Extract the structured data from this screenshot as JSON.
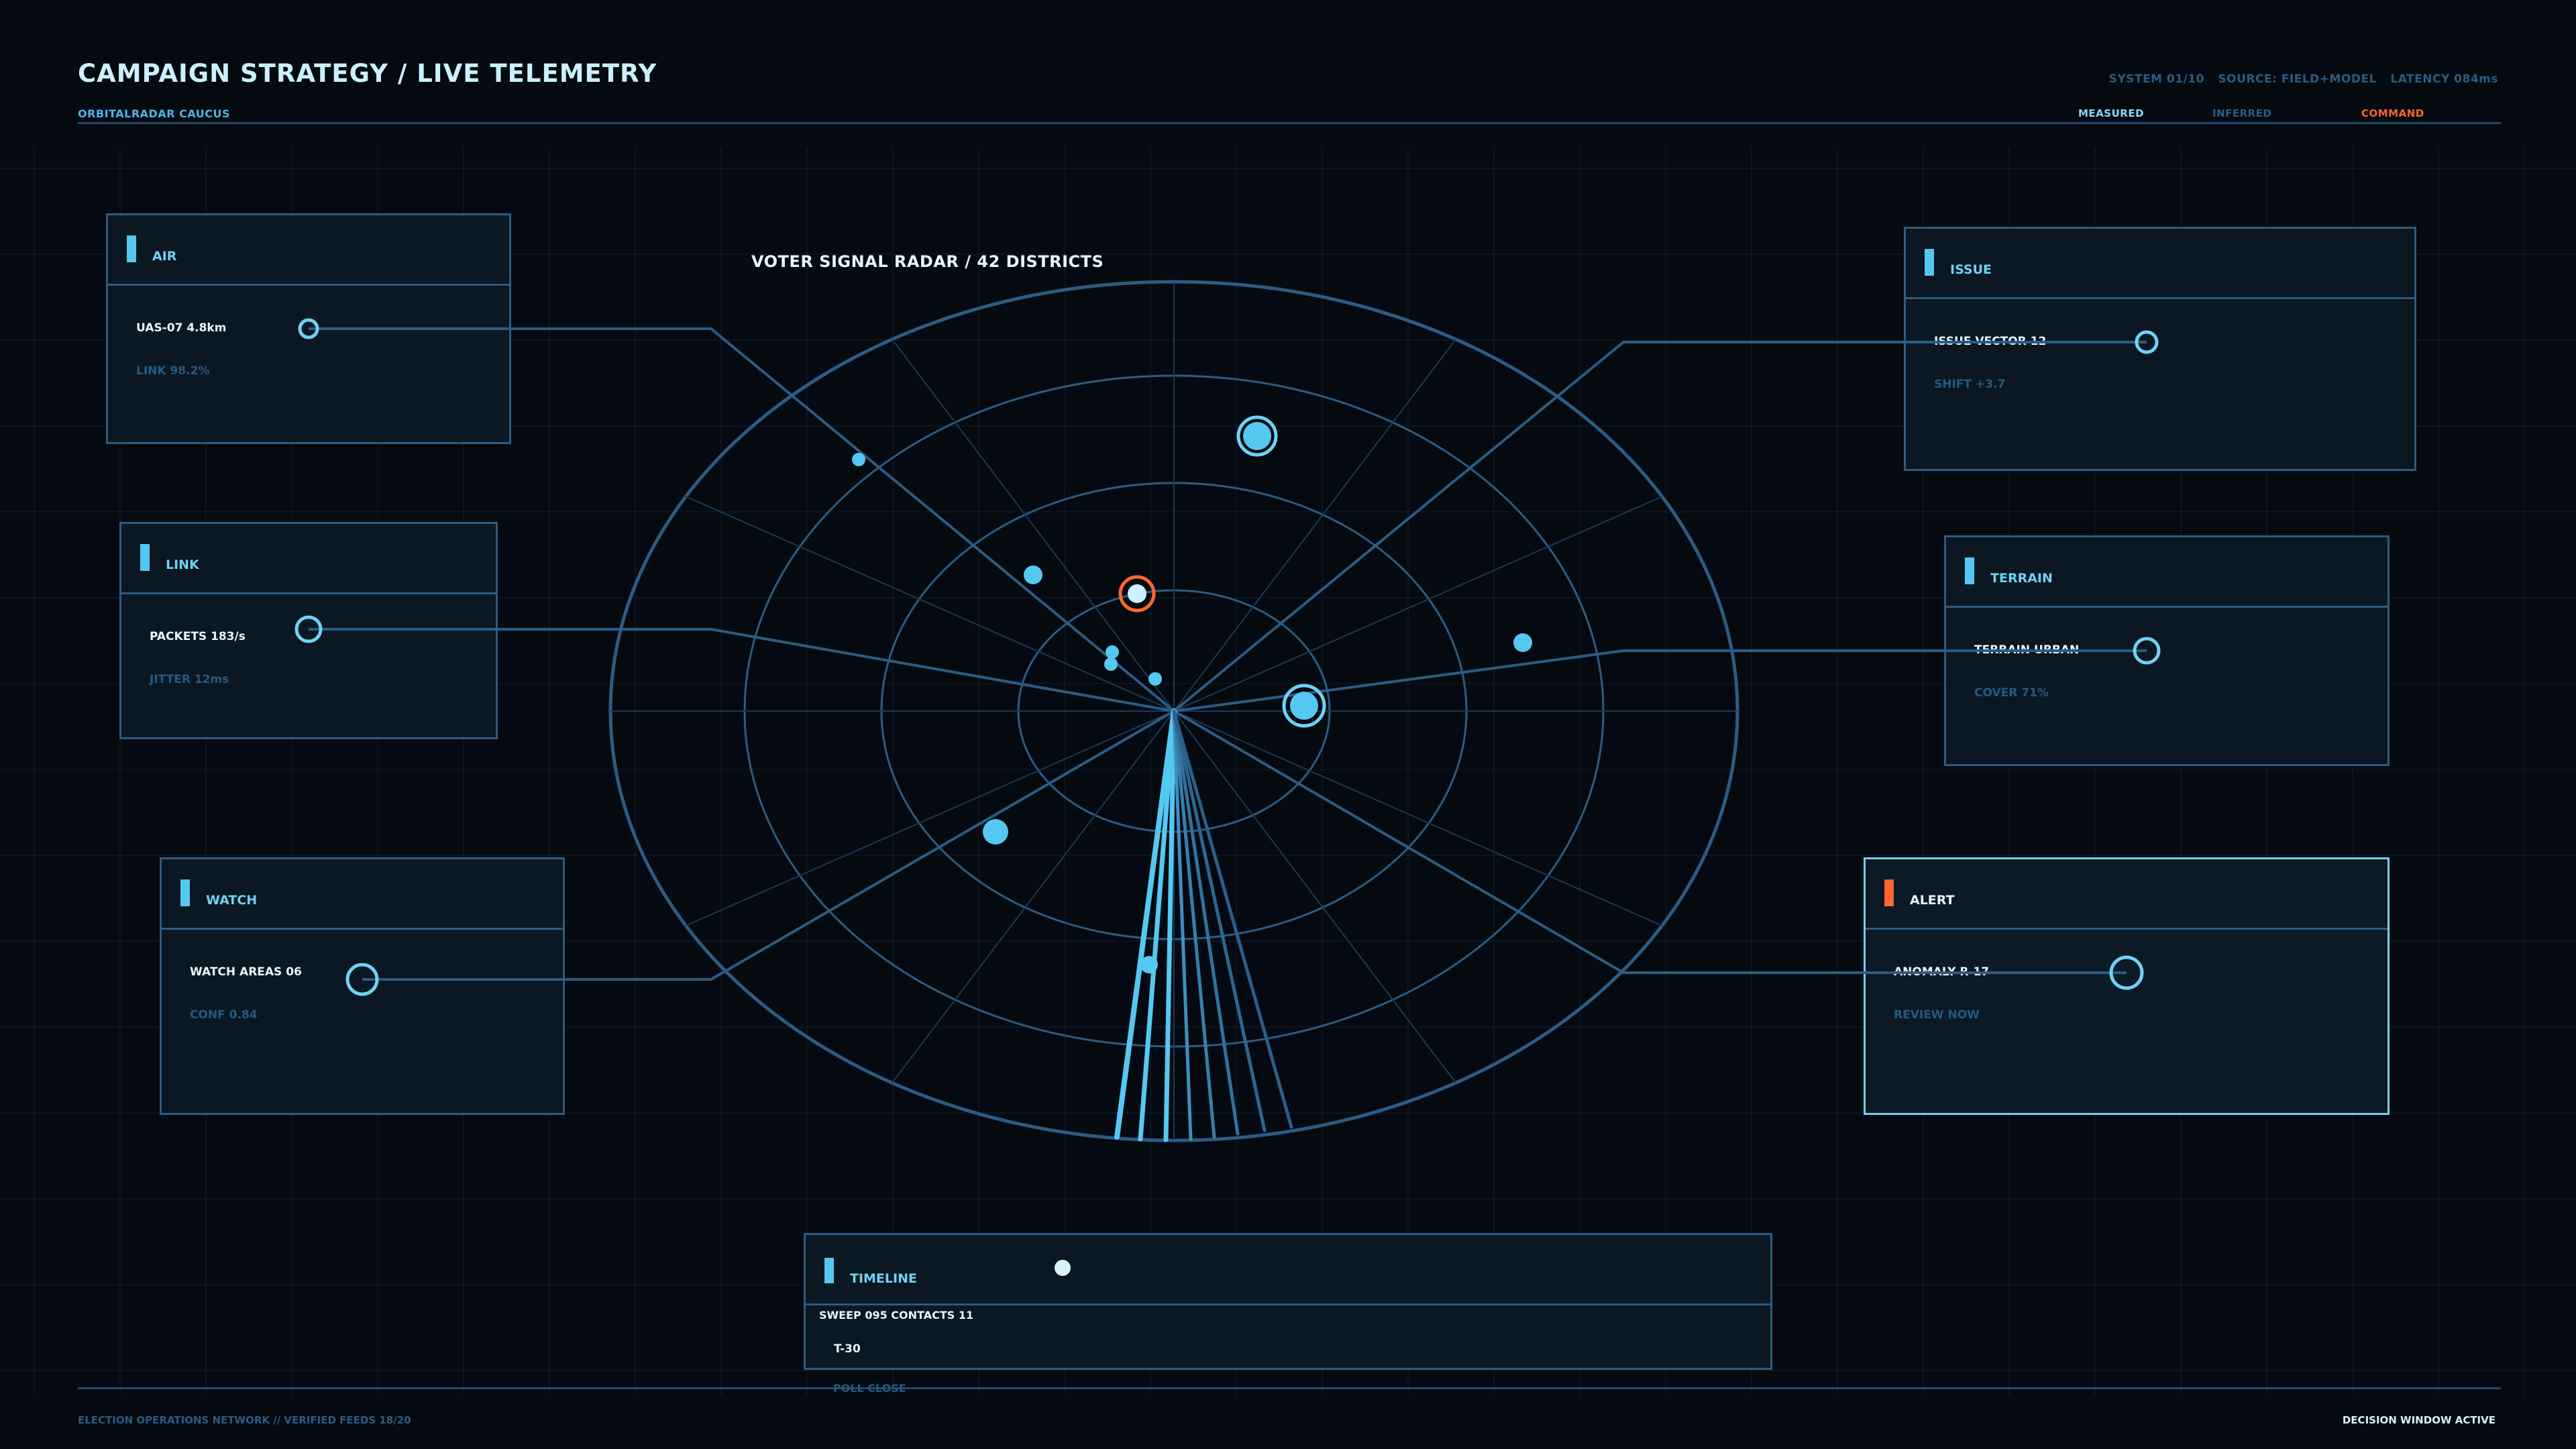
{
  "header": {
    "title": "CAMPAIGN STRATEGY / LIVE TELEMETRY",
    "subtitle": "ORBITALRADAR CAUCUS",
    "system": "SYSTEM 01/10",
    "source": "SOURCE: FIELD+MODEL",
    "latency": "LATENCY 084ms"
  },
  "legend": {
    "measured": "MEASURED",
    "inferred": "INFERRED",
    "command": "COMMAND"
  },
  "radar": {
    "title": "VOTER SIGNAL RADAR / 42 DISTRICTS"
  },
  "panels": {
    "air": {
      "label": "AIR",
      "primary": "UAS-07  4.8km",
      "secondary": "LINK 98.2%"
    },
    "link": {
      "label": "LINK",
      "primary": "PACKETS 183/s",
      "secondary": "JITTER 12ms"
    },
    "watch": {
      "label": "WATCH",
      "primary": "WATCH AREAS 06",
      "secondary": "CONF 0.84"
    },
    "issue": {
      "label": "ISSUE",
      "primary": "ISSUE VECTOR 12",
      "secondary": "SHIFT +3.7"
    },
    "terrain": {
      "label": "TERRAIN",
      "primary": "TERRAIN URBAN",
      "secondary": "COVER 71%"
    },
    "alert": {
      "label": "ALERT",
      "primary": "ANOMALY R-17",
      "secondary": "REVIEW NOW"
    }
  },
  "timeline": {
    "label": "TIMELINE",
    "sweep": "SWEEP 095  CONTACTS 11",
    "marker": "T-30",
    "end_label": "POLL CLOSE"
  },
  "footer": {
    "left": "ELECTION OPERATIONS NETWORK // VERIFIED FEEDS 18/20",
    "right": "DECISION WINDOW ACTIVE"
  },
  "colors": {
    "accent": "#55c8f2",
    "command": "#ff6630",
    "line": "#2c5c82",
    "background": "#050a11"
  }
}
